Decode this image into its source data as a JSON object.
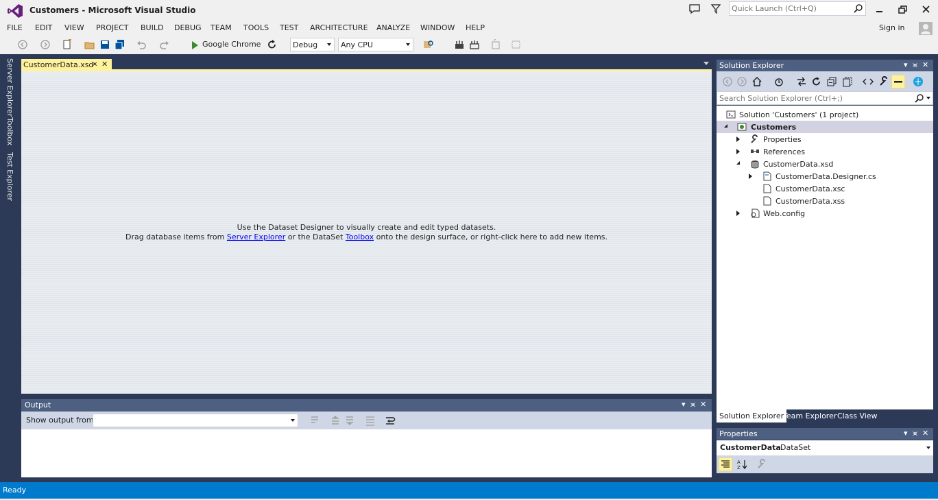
{
  "window": {
    "title": "Customers - Microsoft Visual Studio",
    "quick_launch_placeholder": "Quick Launch (Ctrl+Q)",
    "sign_in": "Sign in"
  },
  "menu": [
    "FILE",
    "EDIT",
    "VIEW",
    "PROJECT",
    "BUILD",
    "DEBUG",
    "TEAM",
    "TOOLS",
    "TEST",
    "ARCHITECTURE",
    "ANALYZE",
    "WINDOW",
    "HELP"
  ],
  "toolbar": {
    "run_target": "Google Chrome",
    "configuration": "Debug",
    "platform": "Any CPU"
  },
  "left_rail": [
    "Server Explorer",
    "Toolbox",
    "Test Explorer"
  ],
  "document": {
    "tab_label": "CustomerData.xsd",
    "message_line1": "Use the Dataset Designer to visually create and edit typed datasets.",
    "message_line2_pre": "Drag database items from ",
    "message_link1": "Server Explorer",
    "message_line2_mid": " or the DataSet ",
    "message_link2": "Toolbox",
    "message_line2_post": " onto the design surface, or right-click here to add new items."
  },
  "output": {
    "title": "Output",
    "show_output_label": "Show output from:",
    "show_output_value": ""
  },
  "solution_explorer": {
    "title": "Solution Explorer",
    "search_placeholder": "Search Solution Explorer (Ctrl+;)",
    "tree": [
      {
        "label": "Solution 'Customers' (1 project)",
        "icon": "solution-icon"
      },
      {
        "label": "Customers",
        "icon": "csharp-web-project-icon"
      },
      {
        "label": "Properties",
        "icon": "wrench-icon"
      },
      {
        "label": "References",
        "icon": "references-icon"
      },
      {
        "label": "CustomerData.xsd",
        "icon": "dataset-icon"
      },
      {
        "label": "CustomerData.Designer.cs",
        "icon": "cs-file-icon"
      },
      {
        "label": "CustomerData.xsc",
        "icon": "file-icon"
      },
      {
        "label": "CustomerData.xss",
        "icon": "file-icon"
      },
      {
        "label": "Web.config",
        "icon": "config-file-icon"
      }
    ],
    "tabs": [
      "Solution Explorer",
      "Team Explorer",
      "Class View"
    ]
  },
  "properties": {
    "title": "Properties",
    "object_name": "CustomerData",
    "object_type": "DataSet"
  },
  "status": {
    "text": "Ready"
  },
  "colors": {
    "frame": "#2d3a57",
    "panel_header": "#4d6082",
    "doc_tab": "#fff29d",
    "status_bar": "#007acc"
  }
}
